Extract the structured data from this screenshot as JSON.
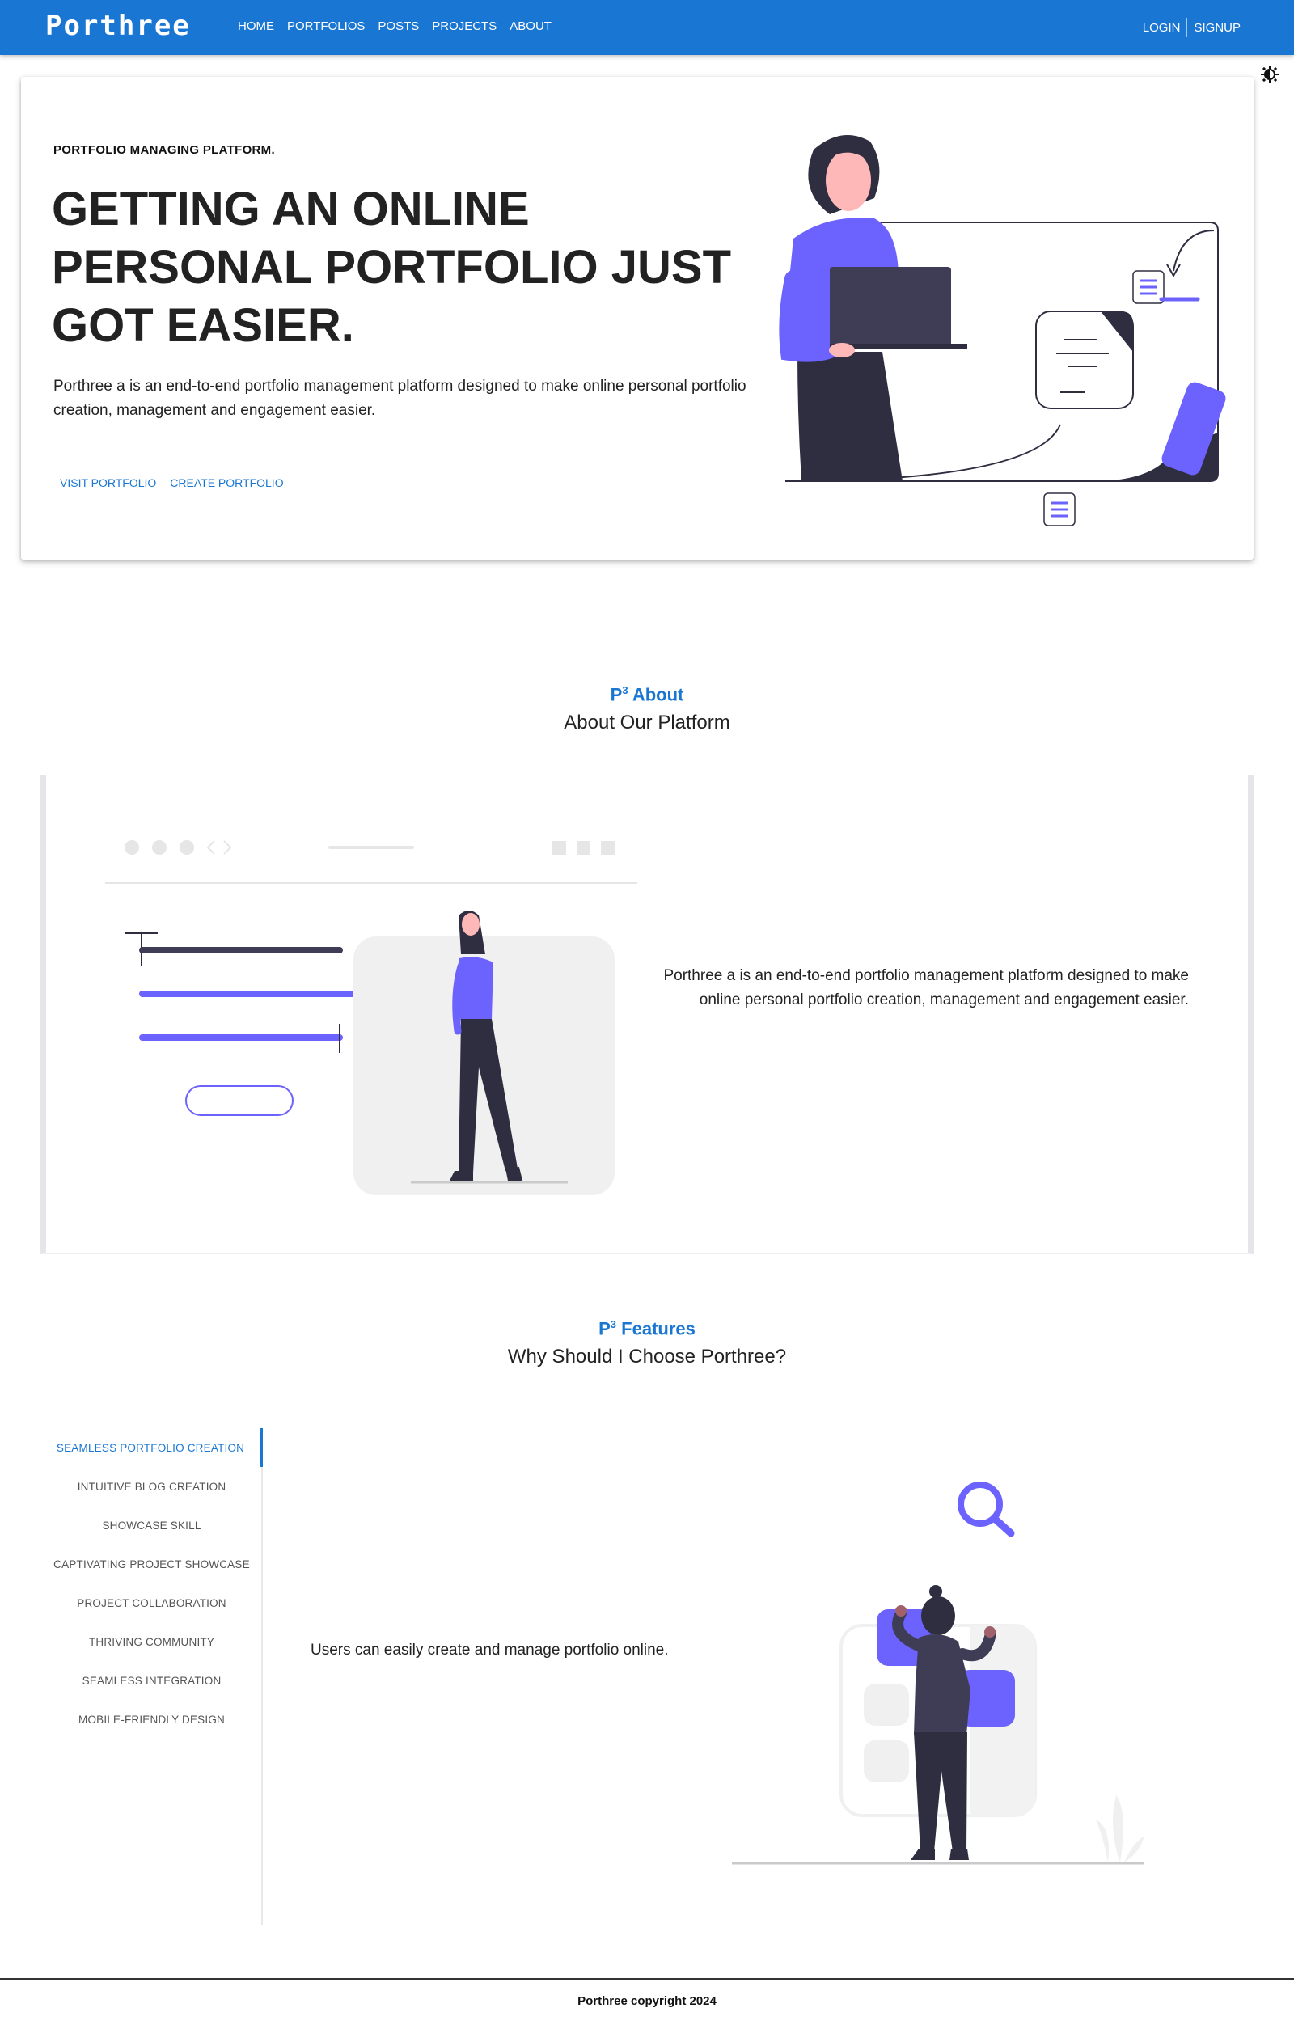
{
  "navbar": {
    "brand": "Porthree",
    "links": [
      "HOME",
      "PORTFOLIOS",
      "POSTS",
      "PROJECTS",
      "ABOUT"
    ],
    "login": "LOGIN",
    "signup": "SIGNUP",
    "theme_icon": "brightness-icon"
  },
  "hero": {
    "eyebrow": "PORTFOLIO MANAGING PLATFORM.",
    "title": "GETTING AN ONLINE PERSONAL PORTFOLIO JUST GOT EASIER.",
    "description": "Porthree a is an end-to-end portfolio management platform designed to make online personal portfolio creation, management and engagement easier.",
    "visit_button": "VISIT PORTFOLIO",
    "create_button": "CREATE PORTFOLIO"
  },
  "about": {
    "kicker_letter": "P",
    "kicker_sup": "3",
    "kicker_word": "About",
    "subtitle": "About Our Platform",
    "text": "Porthree a is an end-to-end portfolio management platform designed to make online personal portfolio creation, management and engagement easier."
  },
  "features": {
    "kicker_letter": "P",
    "kicker_sup": "3",
    "kicker_word": "Features",
    "subtitle": "Why Should I Choose Porthree?",
    "tabs": [
      "SEAMLESS PORTFOLIO CREATION",
      "INTUITIVE BLOG CREATION",
      "SHOWCASE SKILL",
      "CAPTIVATING PROJECT SHOWCASE",
      "PROJECT COLLABORATION",
      "THRIVING COMMUNITY",
      "SEAMLESS INTEGRATION",
      "MOBILE-FRIENDLY DESIGN"
    ],
    "active_tab_index": 0,
    "active_text": "Users can easily create and manage portfolio online."
  },
  "footer": {
    "text": "Porthree copyright 2024"
  },
  "colors": {
    "primary": "#1976d2",
    "accent_purple": "#6c63ff",
    "dark_figure": "#2f2e41"
  }
}
